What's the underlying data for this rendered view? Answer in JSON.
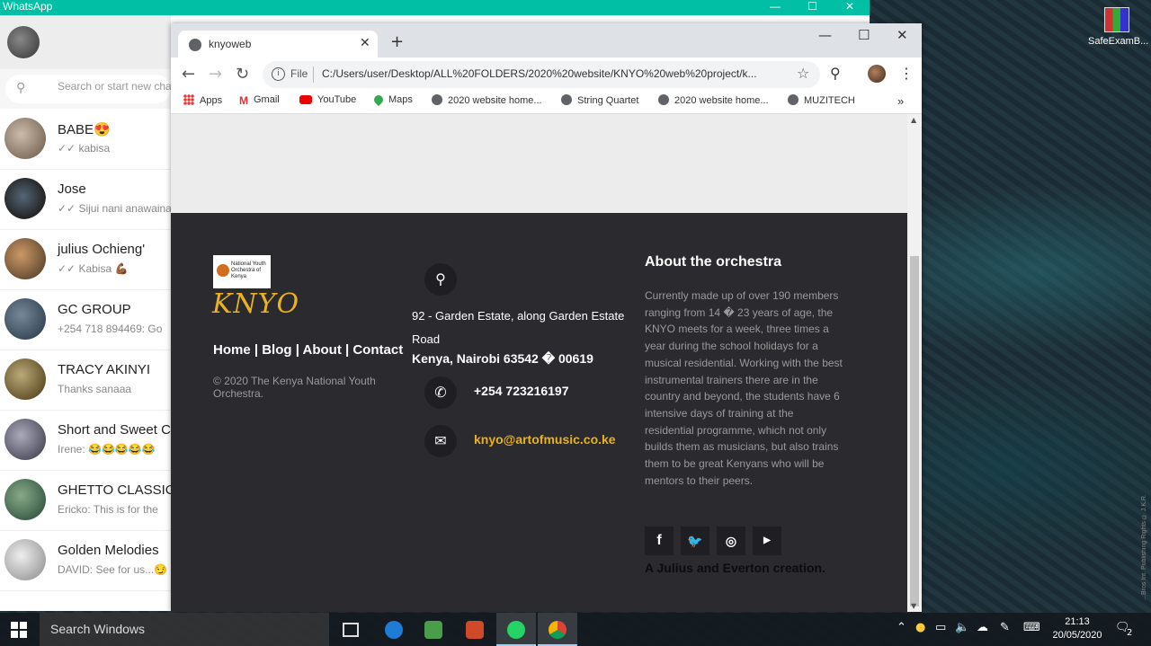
{
  "desktop": {
    "icon_label": "SafeExamB...",
    "vertical_text": "...Bros Int. Publishing Rights © J.K.R."
  },
  "whatsapp": {
    "title": "WhatsApp",
    "search_placeholder": "Search or start new chat",
    "chats": [
      {
        "name": "BABE😍",
        "message": "✓✓ kabisa"
      },
      {
        "name": "Jose",
        "message": "✓✓ Sijui nani anawaina"
      },
      {
        "name": "julius Ochieng'",
        "message": "✓✓ Kabisa 💪🏾"
      },
      {
        "name": "GC GROUP",
        "message": "+254 718 894469: Go"
      },
      {
        "name": "TRACY AKINYI",
        "message": "Thanks sanaaa"
      },
      {
        "name": "Short and Sweet C",
        "message": "Irene: 😂😂😂😂😂"
      },
      {
        "name": "GHETTO CLASSICS",
        "message": "Ericko: This is for the"
      },
      {
        "name": "Golden Melodies",
        "message": "DAVID: See for us...😏"
      }
    ]
  },
  "browser": {
    "tab_title": "knyoweb",
    "new_tab": "+",
    "address_prefix": "File",
    "url": "C:/Users/user/Desktop/ALL%20FOLDERS/2020%20website/KNYO%20web%20project/k...",
    "bookmarks": [
      "Apps",
      "Gmail",
      "YouTube",
      "Maps",
      "2020 website home...",
      "String Quartet",
      "2020 website home...",
      "MUZITECH"
    ],
    "bookmarks_more": "»"
  },
  "site": {
    "logo_small": "National Youth Orchestra of Kenya",
    "logo_word": "KNYO",
    "nav_links": "Home | Blog | About | Contact",
    "copyright": "© 2020 The Kenya National Youth Orchestra.",
    "address_line1": "92 - Garden Estate, along Garden Estate Road",
    "address_line2": "Kenya, Nairobi 63542 � 00619",
    "phone": "+254 723216197",
    "email": "knyo@artofmusic.co.ke",
    "about_heading": "About the orchestra",
    "about_text": "Currently made up of over 190 members ranging from 14 � 23 years of age, the KNYO meets for a week, three times a year during the school holidays for a musical residential. Working with the best instrumental trainers there are in the country and beyond, the students have 6 intensive days of training at the residential programme, which not only builds them as musicians, but also trains them to be great Kenyans who will be mentors to their peers.",
    "social": [
      "f",
      "t",
      "ig",
      "yt"
    ],
    "credit": "A Julius and Everton creation."
  },
  "taskbar": {
    "search_label": "Search Windows",
    "time": "21:13",
    "date": "20/05/2020",
    "notification_count": "2"
  },
  "colors": {
    "whatsapp_green": "#00bfa5",
    "footer_bg": "#2b2a2f",
    "accent_gold": "#e9b21e"
  }
}
